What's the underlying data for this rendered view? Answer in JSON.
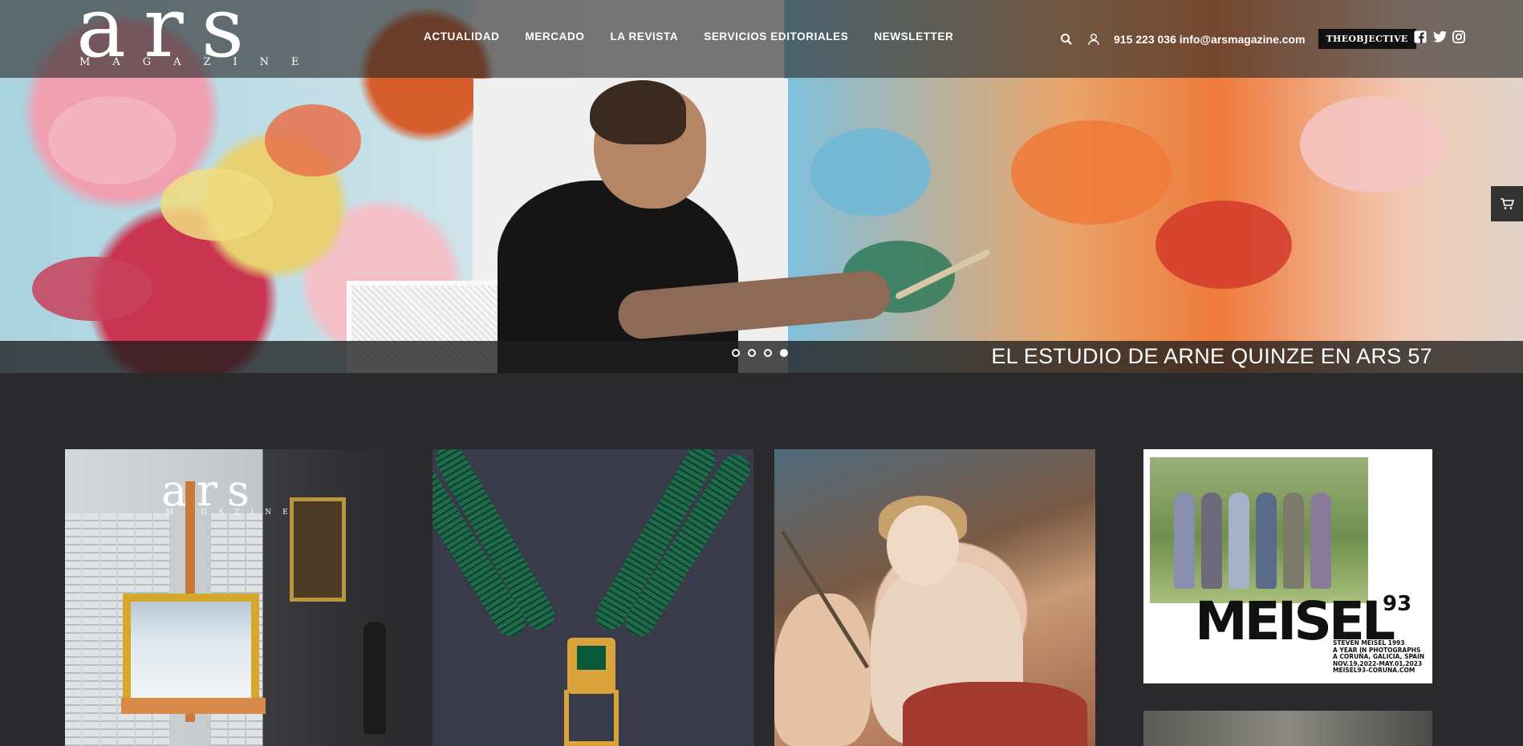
{
  "brand": {
    "logo_word": "ars",
    "logo_sub": "MAGAZINE"
  },
  "nav": {
    "items": [
      {
        "label": "ACTUALIDAD"
      },
      {
        "label": "MERCADO"
      },
      {
        "label": "LA REVISTA"
      },
      {
        "label": "SERVICIOS EDITORIALES"
      },
      {
        "label": "NEWSLETTER"
      }
    ]
  },
  "header_tools": {
    "search_icon": "search-icon",
    "user_icon": "user-icon",
    "phone": "915 223 036",
    "email": "info@arsmagazine.com",
    "partner_logo_text": "THEOBJECTIVE"
  },
  "socials": [
    {
      "icon": "facebook-icon"
    },
    {
      "icon": "twitter-icon"
    },
    {
      "icon": "instagram-icon"
    }
  ],
  "slider": {
    "caption": "EL ESTUDIO DE ARNE QUINZE EN ARS 57",
    "dots_total": 4,
    "active_index": 3
  },
  "cart": {
    "icon": "cart-icon"
  },
  "cards": {
    "cover": {
      "word": "ars",
      "sub": "MAGAZINE"
    },
    "meisel_ad": {
      "title": "MEISEL",
      "title_sup": "93",
      "lines": [
        "STEVEN MEISEL 1993",
        "A YEAR IN PHOTOGRAPHS",
        "A CORUÑA, GALICIA, SPAIN",
        "NOV.19,2022-MAY.01,2023",
        "MEISEL93-CORUNA.COM"
      ]
    }
  },
  "colors": {
    "page_bg": "#2a2a2c",
    "header_bg": "rgba(40,40,40,0.62)",
    "text": "#ffffff"
  }
}
